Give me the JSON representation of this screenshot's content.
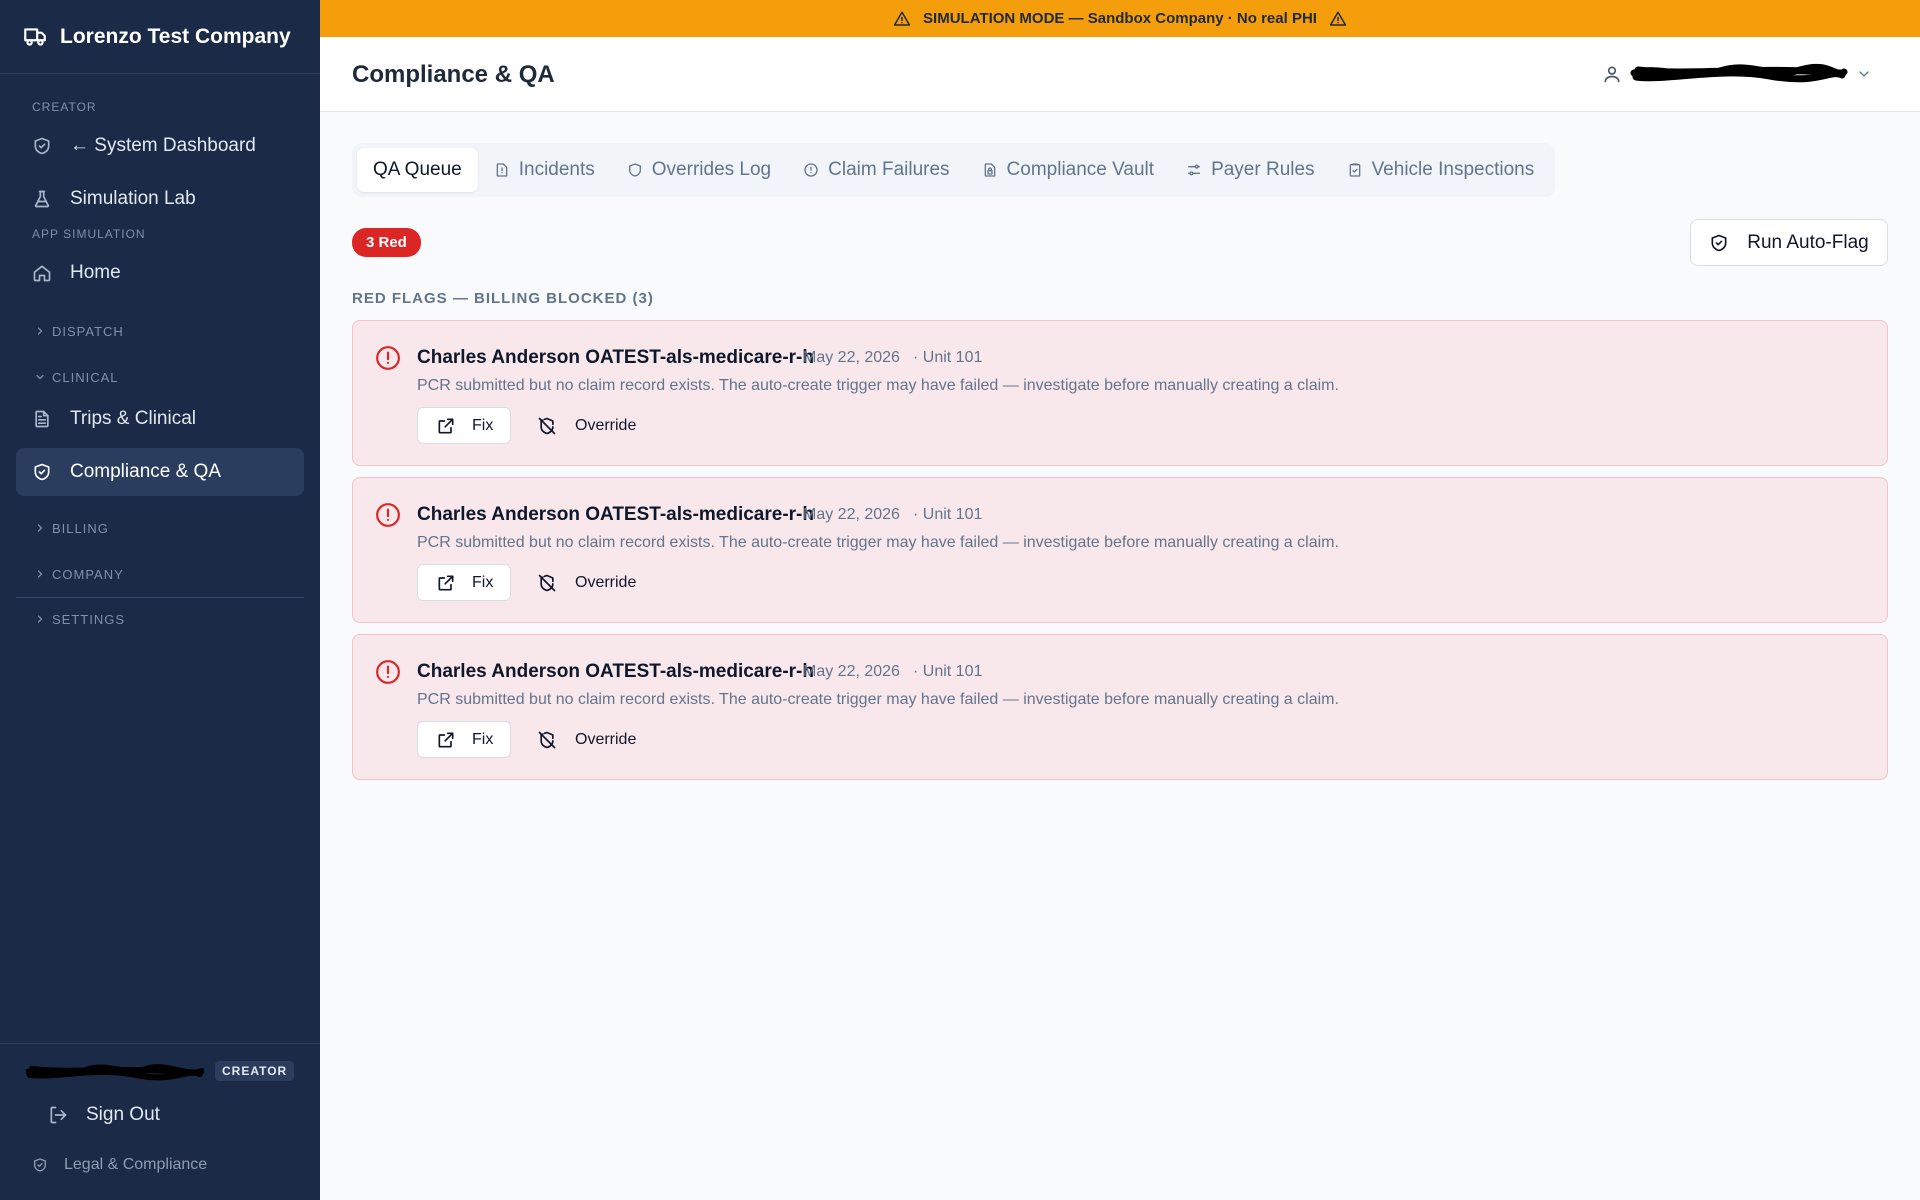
{
  "sidebar": {
    "brand": "Lorenzo Test Company",
    "brand_icon": "truck-icon",
    "sections": {
      "creator": "CREATOR",
      "app_simulation": "APP SIMULATION"
    },
    "items": {
      "system_dashboard": "← System Dashboard",
      "simulation_lab": "Simulation Lab",
      "home": "Home",
      "trips_clinical": "Trips & Clinical",
      "compliance_qa": "Compliance & QA"
    },
    "groups": {
      "dispatch": "DISPATCH",
      "clinical": "CLINICAL",
      "billing": "BILLING",
      "company": "COMPANY",
      "settings": "SETTINGS"
    },
    "footer": {
      "role_badge": "CREATOR",
      "sign_out": "Sign Out",
      "legal": "Legal & Compliance"
    }
  },
  "banner": {
    "text": "SIMULATION MODE — Sandbox Company · No real PHI",
    "color": "#f59e0b"
  },
  "header": {
    "title": "Compliance & QA"
  },
  "tabs": [
    {
      "label": "QA Queue",
      "active": true
    },
    {
      "label": "Incidents",
      "icon": "file-alert-icon"
    },
    {
      "label": "Overrides Log",
      "icon": "shield-icon"
    },
    {
      "label": "Claim Failures",
      "icon": "alert-circle-icon"
    },
    {
      "label": "Compliance Vault",
      "icon": "file-lock-icon"
    },
    {
      "label": "Payer Rules",
      "icon": "sliders-icon"
    },
    {
      "label": "Vehicle Inspections",
      "icon": "clipboard-check-icon"
    }
  ],
  "queue": {
    "red_count_badge": "3 Red",
    "run_auto_flag": "Run Auto-Flag",
    "section_heading": "RED FLAGS — BILLING BLOCKED (3)",
    "flags": [
      {
        "title": "Charles Anderson OATEST-als-medicare-r-h",
        "date": "May 22, 2026",
        "unit": "· Unit 101",
        "description": "PCR submitted but no claim record exists. The auto-create trigger may have failed — investigate before manually creating a claim.",
        "fix_label": "Fix",
        "override_label": "Override"
      },
      {
        "title": "Charles Anderson OATEST-als-medicare-r-h",
        "date": "May 22, 2026",
        "unit": "· Unit 101",
        "description": "PCR submitted but no claim record exists. The auto-create trigger may have failed — investigate before manually creating a claim.",
        "fix_label": "Fix",
        "override_label": "Override"
      },
      {
        "title": "Charles Anderson OATEST-als-medicare-r-h",
        "date": "May 22, 2026",
        "unit": "· Unit 101",
        "description": "PCR submitted but no claim record exists. The auto-create trigger may have failed — investigate before manually creating a claim.",
        "fix_label": "Fix",
        "override_label": "Override"
      }
    ]
  },
  "colors": {
    "sidebar_bg": "#1b2a47",
    "danger": "#dc2626",
    "card_bg": "#f8e8ec"
  }
}
